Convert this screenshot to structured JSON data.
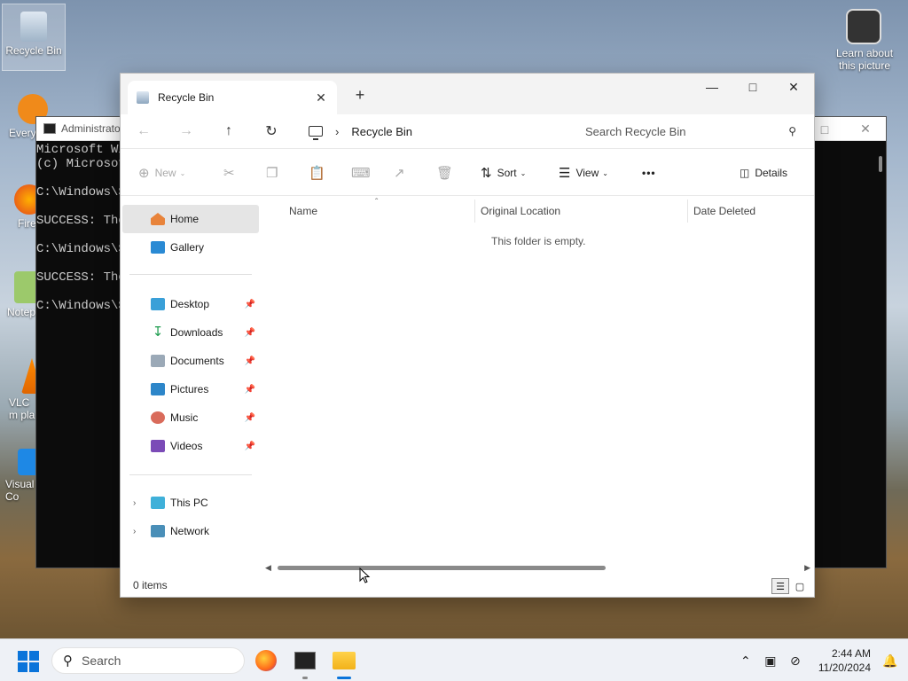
{
  "desktop": {
    "recycle_bin": "Recycle Bin",
    "learn_about": "Learn about this picture",
    "everything": "Every",
    "firefox": "Fire",
    "notepad": "Notep",
    "vlc": "VLC m pla",
    "vscode": "Visual Co"
  },
  "terminal": {
    "title": "Administrato",
    "lines": "Microsoft Wi\n(c) Microsof\n\nC:\\Windows\\S\n\nSUCCESS: The\n\nC:\\Windows\\S\n\nSUCCESS: The\n\nC:\\Windows\\S"
  },
  "explorer": {
    "tab_title": "Recycle Bin",
    "breadcrumb": "Recycle Bin",
    "search_placeholder": "Search Recycle Bin",
    "toolbar": {
      "new": "New",
      "sort": "Sort",
      "view": "View",
      "more": "•••",
      "details": "Details"
    },
    "nav": {
      "home": "Home",
      "gallery": "Gallery",
      "desktop": "Desktop",
      "downloads": "Downloads",
      "documents": "Documents",
      "pictures": "Pictures",
      "music": "Music",
      "videos": "Videos",
      "this_pc": "This PC",
      "network": "Network"
    },
    "columns": [
      "Name",
      "Original Location",
      "Date Deleted"
    ],
    "empty_message": "This folder is empty.",
    "status": "0 items"
  },
  "taskbar": {
    "search": "Search",
    "time": "2:44 AM",
    "date": "11/20/2024"
  },
  "colors": {
    "accent": "#0a74da",
    "selected_nav": "#e5e5e5"
  }
}
